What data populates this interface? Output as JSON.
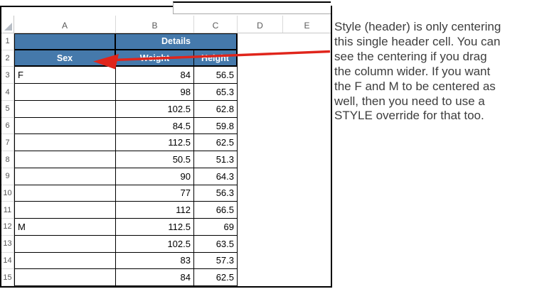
{
  "colors": {
    "header_blue": "#4579AB",
    "header_text": "#FFFFFF",
    "arrow_red": "#E0251B",
    "annotation_text": "#3D3D3D",
    "grid_border": "#000000"
  },
  "icons": {
    "select_all": "select-all-triangle"
  },
  "sheet": {
    "name_box_value": "",
    "column_letters": [
      "A",
      "B",
      "C",
      "D",
      "E"
    ],
    "row1": {
      "num": "1",
      "details": "Details"
    },
    "row2": {
      "num": "2",
      "sex": "Sex",
      "weight": "Weight",
      "height": "Height"
    },
    "data_rows": [
      {
        "num": "3",
        "sex": "F",
        "weight": "84",
        "height": "56.5"
      },
      {
        "num": "4",
        "sex": "",
        "weight": "98",
        "height": "65.3"
      },
      {
        "num": "5",
        "sex": "",
        "weight": "102.5",
        "height": "62.8"
      },
      {
        "num": "6",
        "sex": "",
        "weight": "84.5",
        "height": "59.8"
      },
      {
        "num": "7",
        "sex": "",
        "weight": "112.5",
        "height": "62.5"
      },
      {
        "num": "8",
        "sex": "",
        "weight": "50.5",
        "height": "51.3"
      },
      {
        "num": "9",
        "sex": "",
        "weight": "90",
        "height": "64.3"
      },
      {
        "num": "10",
        "sex": "",
        "weight": "77",
        "height": "56.3"
      },
      {
        "num": "11",
        "sex": "",
        "weight": "112",
        "height": "66.5"
      },
      {
        "num": "12",
        "sex": "M",
        "weight": "112.5",
        "height": "69"
      },
      {
        "num": "13",
        "sex": "",
        "weight": "102.5",
        "height": "63.5"
      },
      {
        "num": "14",
        "sex": "",
        "weight": "83",
        "height": "57.3"
      },
      {
        "num": "15",
        "sex": "",
        "weight": "84",
        "height": "62.5"
      }
    ]
  },
  "annotation": {
    "lines": [
      "Style (header) is only centering",
      "this single header cell. You can",
      "see the centering if you drag",
      "the column wider. If you want",
      "the F and M to be centered as",
      "well, then you need to use a",
      "STYLE override for that too."
    ]
  }
}
